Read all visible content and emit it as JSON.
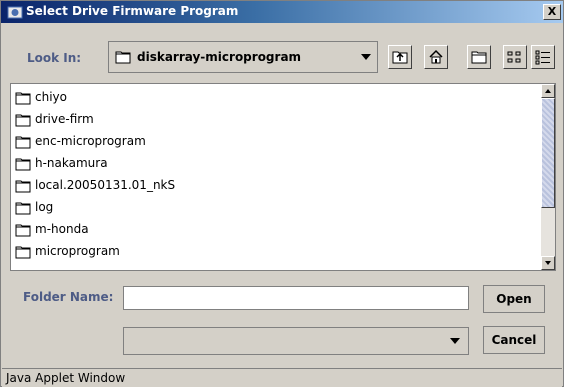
{
  "window": {
    "title": "Select Drive Firmware Program",
    "close_label": "X"
  },
  "look_in": {
    "label": "Look In:",
    "value": "diskarray-microprogram"
  },
  "toolbar": [
    {
      "name": "up-folder-icon"
    },
    {
      "name": "home-icon"
    },
    {
      "name": "new-folder-icon"
    },
    {
      "name": "list-view-icon"
    },
    {
      "name": "details-view-icon"
    }
  ],
  "files": [
    {
      "label": "chiyo"
    },
    {
      "label": "drive-firm"
    },
    {
      "label": "enc-microprogram"
    },
    {
      "label": "h-nakamura"
    },
    {
      "label": "local.20050131.01_nkS"
    },
    {
      "label": "log"
    },
    {
      "label": "m-honda"
    },
    {
      "label": "microprogram"
    }
  ],
  "folder_name": {
    "label": "Folder Name:",
    "value": ""
  },
  "filter": {
    "value": ""
  },
  "buttons": {
    "open": "Open",
    "cancel": "Cancel"
  },
  "status": {
    "text": "Java Applet Window"
  },
  "colors": {
    "title_start": "#0a246a",
    "title_end": "#a6caf0",
    "label": "#4e5c86",
    "window_bg": "#d4d0c8"
  }
}
